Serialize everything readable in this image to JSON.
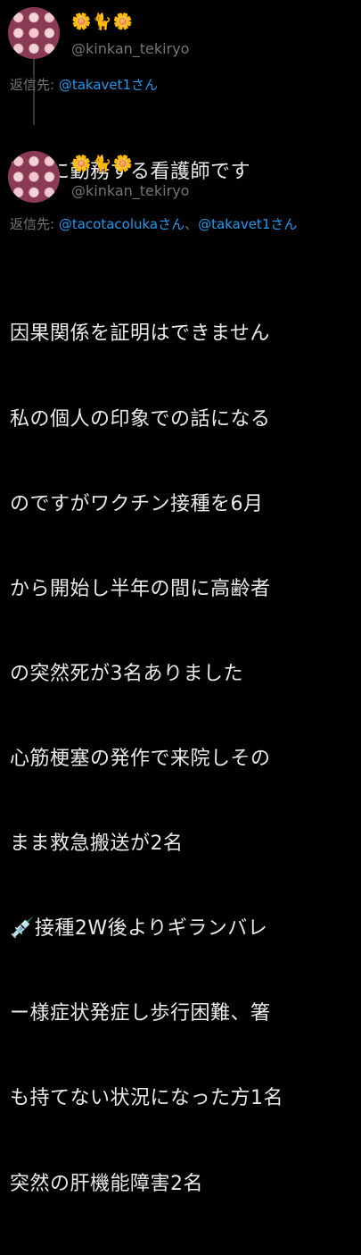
{
  "tweets": [
    {
      "display_name": "🌼🐈🌼",
      "handle": "@kinkan_tekiryo",
      "replying_prefix": "返信先: ",
      "replying_to": [
        "@takavet1さん"
      ],
      "replying_sep": "",
      "body_lines": [
        "医院に勤務する看護師です"
      ]
    },
    {
      "display_name": "🌼🐈🌼",
      "handle": "@kinkan_tekiryo",
      "replying_prefix": "返信先: ",
      "replying_to": [
        "@tacotacolukaさん",
        "@takavet1さん"
      ],
      "replying_sep": "、",
      "body_lines": [
        "因果関係を証明はできません",
        "私の個人の印象での話になる",
        "のですがワクチン接種を6月",
        "から開始し半年の間に高齢者",
        "の突然死が3名ありました",
        "心筋梗塞の発作で来院しその",
        "まま救急搬送が2名",
        "💉接種2W後よりギランバレ",
        "ー様症状発症し歩行困難、箸",
        "も持てない状況になった方1名",
        "突然の肝機能障害2名"
      ]
    }
  ],
  "colors": {
    "background": "#000000",
    "text": "#e7e9ea",
    "secondary": "#71767b",
    "link": "#1d9bf0"
  }
}
